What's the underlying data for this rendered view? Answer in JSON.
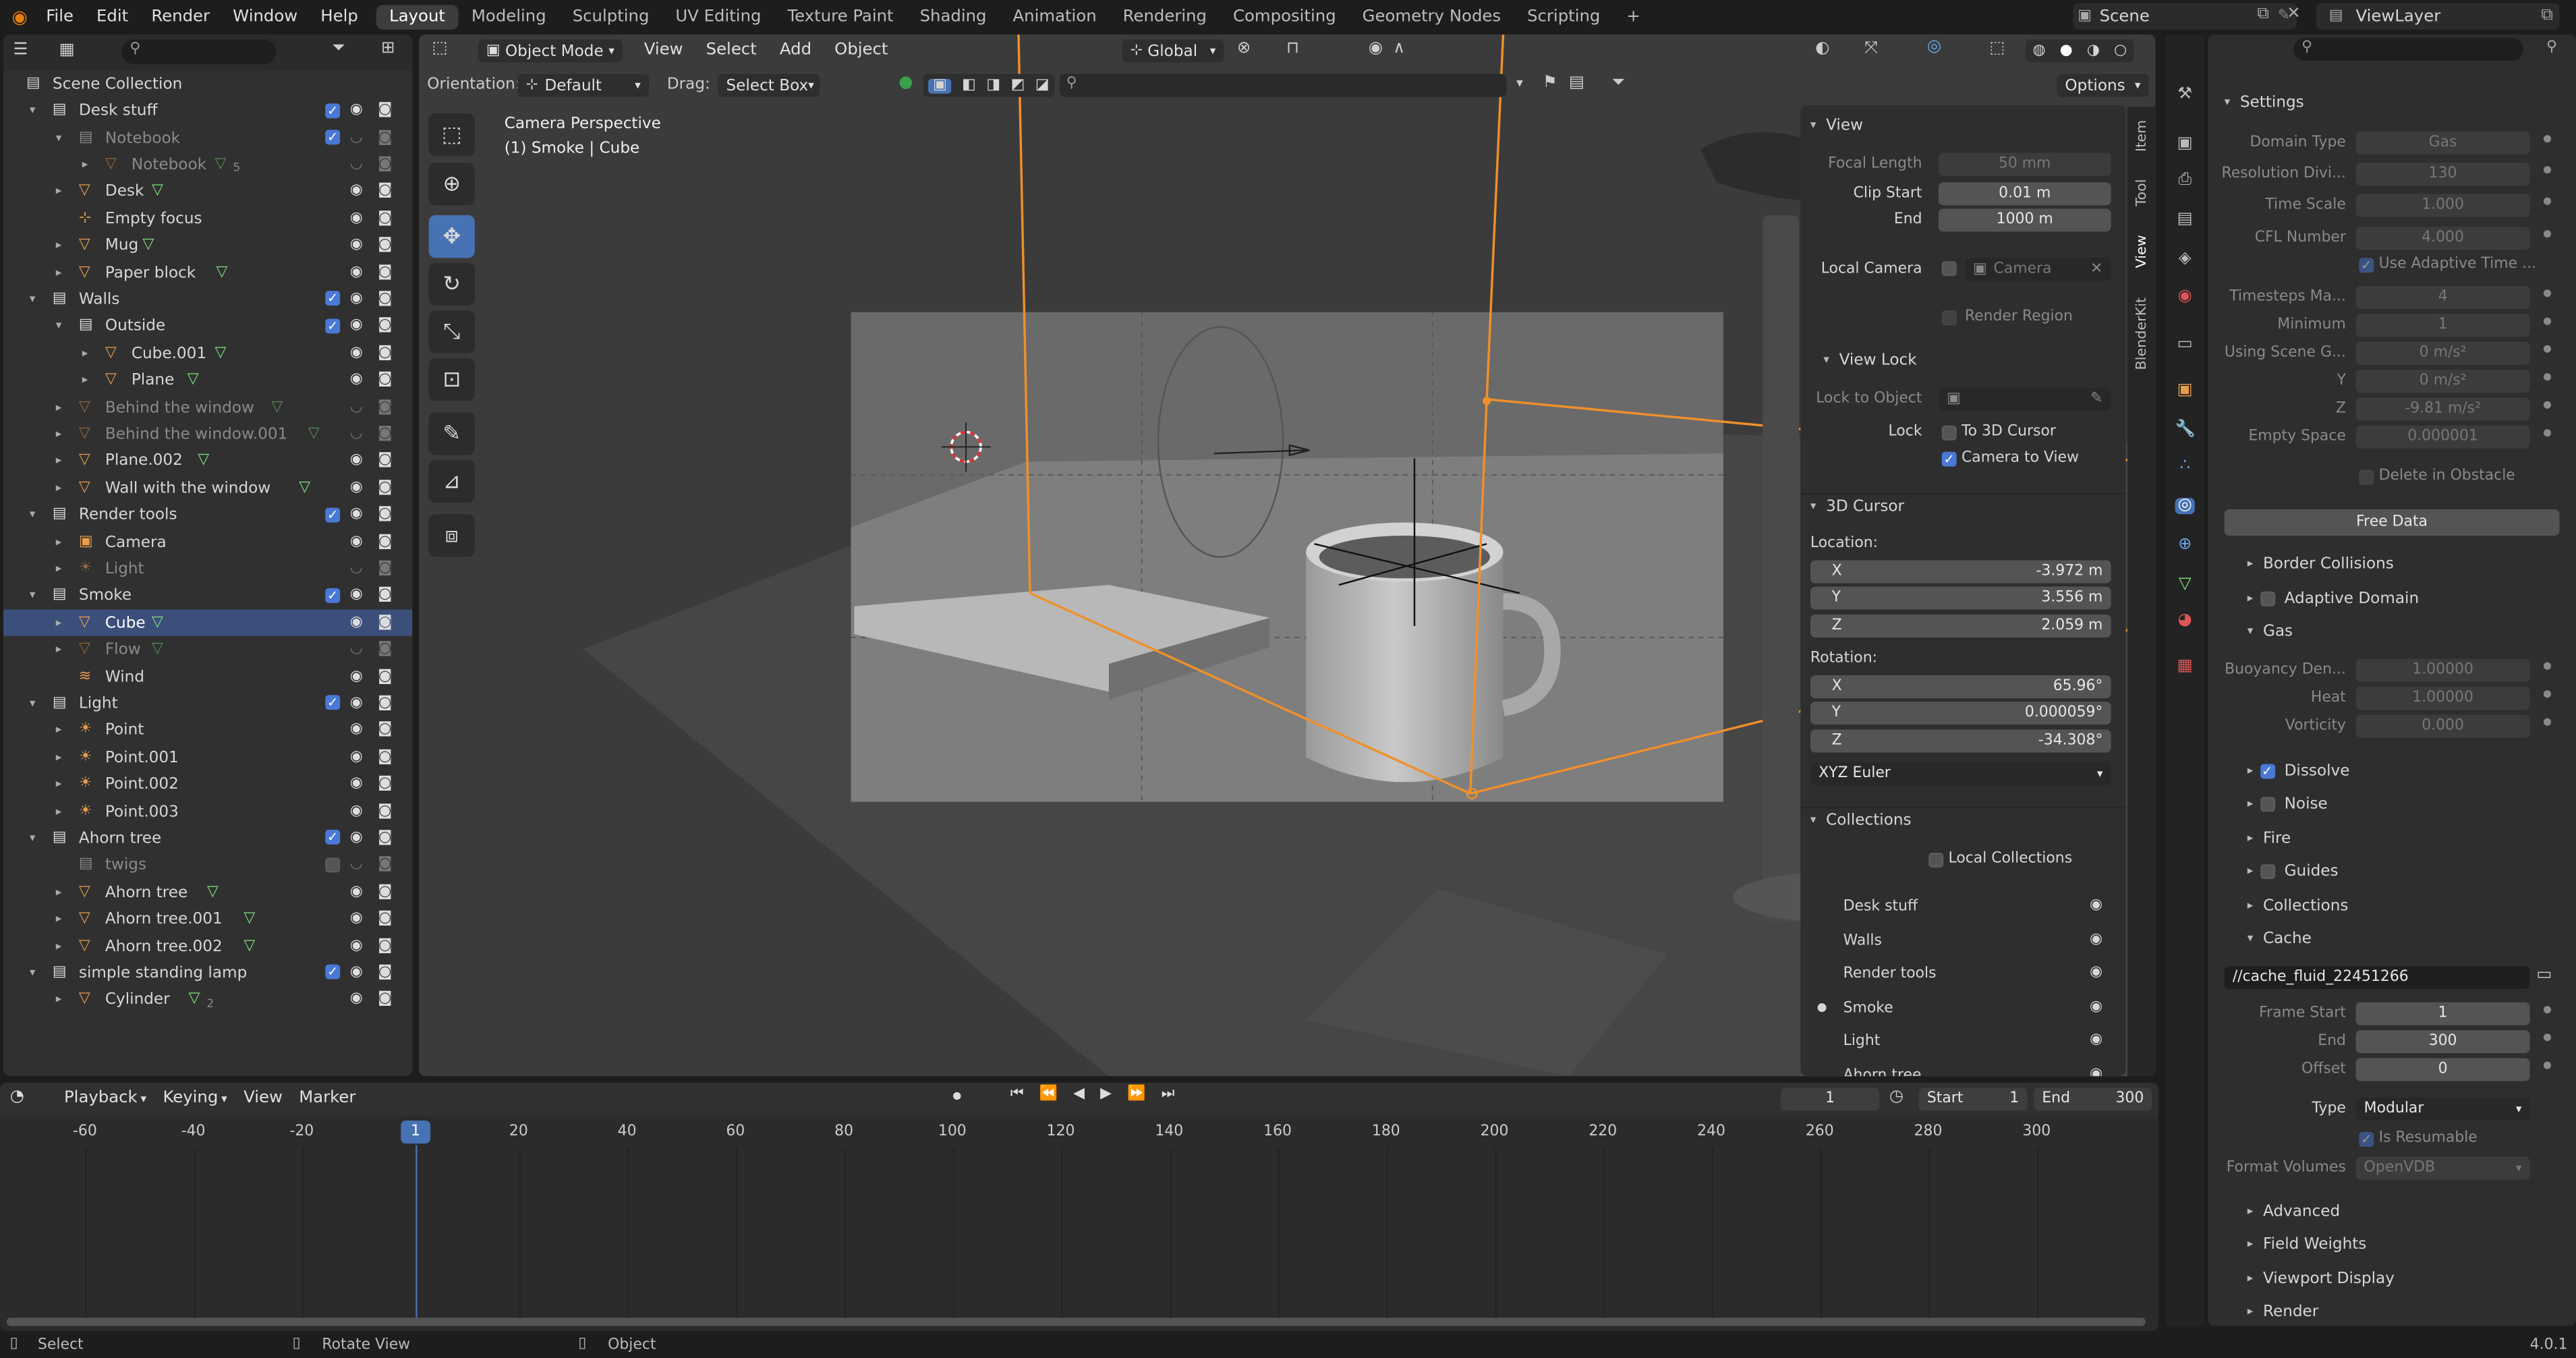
{
  "topbar": {
    "menus": [
      "File",
      "Edit",
      "Render",
      "Window",
      "Help"
    ],
    "workspaces": [
      "Layout",
      "Modeling",
      "Sculpting",
      "UV Editing",
      "Texture Paint",
      "Shading",
      "Animation",
      "Rendering",
      "Compositing",
      "Geometry Nodes",
      "Scripting"
    ],
    "active_workspace": "Layout",
    "scene": "Scene",
    "view_layer": "ViewLayer"
  },
  "outliner": {
    "root": "Scene Collection",
    "rows": [
      {
        "label": "Desk stuff",
        "depth": 1,
        "type": "collection",
        "expand": "down",
        "check": true
      },
      {
        "label": "Notebook",
        "depth": 2,
        "type": "collection",
        "expand": "down",
        "check": true,
        "dim": true
      },
      {
        "label": "Notebook",
        "depth": 3,
        "type": "object",
        "expand": "right",
        "dim": true,
        "badge": "5"
      },
      {
        "label": "Desk",
        "depth": 2,
        "type": "object",
        "expand": "right"
      },
      {
        "label": "Empty focus",
        "depth": 2,
        "type": "empty",
        "expand": ""
      },
      {
        "label": "Mug",
        "depth": 2,
        "type": "object",
        "expand": "right"
      },
      {
        "label": "Paper block",
        "depth": 2,
        "type": "object",
        "expand": "right"
      },
      {
        "label": "Walls",
        "depth": 1,
        "type": "collection",
        "expand": "down",
        "check": true
      },
      {
        "label": "Outside",
        "depth": 2,
        "type": "collection",
        "expand": "down",
        "check": true
      },
      {
        "label": "Cube.001",
        "depth": 3,
        "type": "object",
        "expand": "right"
      },
      {
        "label": "Plane",
        "depth": 3,
        "type": "object",
        "expand": "right"
      },
      {
        "label": "Behind the window",
        "depth": 2,
        "type": "object",
        "expand": "right",
        "dim": true
      },
      {
        "label": "Behind the window.001",
        "depth": 2,
        "type": "object",
        "expand": "right",
        "dim": true
      },
      {
        "label": "Plane.002",
        "depth": 2,
        "type": "object",
        "expand": "right"
      },
      {
        "label": "Wall with the window",
        "depth": 2,
        "type": "object",
        "expand": "right"
      },
      {
        "label": "Render tools",
        "depth": 1,
        "type": "collection",
        "expand": "down",
        "check": true
      },
      {
        "label": "Camera",
        "depth": 2,
        "type": "camera",
        "expand": "right"
      },
      {
        "label": "Light",
        "depth": 2,
        "type": "light",
        "expand": "right",
        "dim": true
      },
      {
        "label": "Smoke",
        "depth": 1,
        "type": "collection",
        "expand": "down",
        "check": true
      },
      {
        "label": "Cube",
        "depth": 2,
        "type": "object",
        "expand": "right",
        "selected": true
      },
      {
        "label": "Flow",
        "depth": 2,
        "type": "object",
        "expand": "right",
        "dim": true
      },
      {
        "label": "Wind",
        "depth": 2,
        "type": "force",
        "expand": ""
      },
      {
        "label": "Light",
        "depth": 1,
        "type": "collection",
        "expand": "down",
        "check": true
      },
      {
        "label": "Point",
        "depth": 2,
        "type": "light",
        "expand": "right"
      },
      {
        "label": "Point.001",
        "depth": 2,
        "type": "light",
        "expand": "right"
      },
      {
        "label": "Point.002",
        "depth": 2,
        "type": "light",
        "expand": "right"
      },
      {
        "label": "Point.003",
        "depth": 2,
        "type": "light",
        "expand": "right"
      },
      {
        "label": "Ahorn tree",
        "depth": 1,
        "type": "collection",
        "expand": "down",
        "check": true
      },
      {
        "label": "twigs",
        "depth": 2,
        "type": "collection",
        "expand": "",
        "dim": true,
        "check": false
      },
      {
        "label": "Ahorn tree",
        "depth": 2,
        "type": "object",
        "expand": "right"
      },
      {
        "label": "Ahorn tree.001",
        "depth": 2,
        "type": "object",
        "expand": "right"
      },
      {
        "label": "Ahorn tree.002",
        "depth": 2,
        "type": "object",
        "expand": "right"
      },
      {
        "label": "simple standing lamp",
        "depth": 1,
        "type": "collection",
        "expand": "down",
        "check": true
      },
      {
        "label": "Cylinder",
        "depth": 2,
        "type": "object",
        "expand": "right",
        "badge": "2"
      }
    ]
  },
  "viewport": {
    "mode": "Object Mode",
    "menus": [
      "View",
      "Select",
      "Add",
      "Object"
    ],
    "transform": "Global",
    "orientation_label": "Orientation:",
    "orientation": "Default",
    "drag_label": "Drag:",
    "drag": "Select Box",
    "options": "Options",
    "overlay_title": "Camera Perspective",
    "overlay_sub": "(1) Smoke | Cube"
  },
  "npanel": {
    "tabs": [
      "Item",
      "Tool",
      "View",
      "BlenderKit"
    ],
    "view": {
      "title": "View",
      "focal_label": "Focal Length",
      "focal": "50 mm",
      "clip_start_label": "Clip Start",
      "clip_start": "0.01 m",
      "end_label": "End",
      "clip_end": "1000 m",
      "local_camera_label": "Local Camera",
      "camera": "Camera",
      "render_region": "Render Region"
    },
    "view_lock": {
      "title": "View Lock",
      "lock_obj_label": "Lock to Object",
      "lock_label": "Lock",
      "to_cursor": "To 3D Cursor",
      "cam_to_view": "Camera to View"
    },
    "cursor": {
      "title": "3D Cursor",
      "location": "Location:",
      "loc": [
        [
          "X",
          "-3.972 m"
        ],
        [
          "Y",
          "3.556 m"
        ],
        [
          "Z",
          "2.059 m"
        ]
      ],
      "rotation": "Rotation:",
      "rot": [
        [
          "X",
          "65.96°"
        ],
        [
          "Y",
          "0.000059°"
        ],
        [
          "Z",
          "-34.308°"
        ]
      ],
      "mode": "XYZ Euler"
    },
    "collections": {
      "title": "Collections",
      "local": "Local Collections",
      "items": [
        "Desk stuff",
        "Walls",
        "Render tools",
        "Smoke",
        "Light",
        "Ahorn tree"
      ],
      "active": "Smoke"
    }
  },
  "properties": {
    "settings_title": "Settings",
    "rows": [
      [
        "Domain Type",
        "Gas"
      ],
      [
        "Resolution Divi...",
        "130"
      ],
      [
        "Time Scale",
        "1.000"
      ],
      [
        "CFL Number",
        "4.000"
      ]
    ],
    "adaptive_time": "Use Adaptive Time ...",
    "rows2": [
      [
        "Timesteps Ma...",
        "4"
      ],
      [
        "Minimum",
        "1"
      ],
      [
        "Using Scene G...",
        "0 m/s²"
      ],
      [
        "Y",
        "0 m/s²"
      ],
      [
        "Z",
        "-9.81 m/s²"
      ],
      [
        "Empty Space",
        "0.000001"
      ]
    ],
    "delete_obstacle": "Delete in Obstacle",
    "free_data": "Free Data",
    "border_collisions": "Border Collisions",
    "adaptive_domain": "Adaptive Domain",
    "gas": "Gas",
    "gas_rows": [
      [
        "Buoyancy Den...",
        "1.00000"
      ],
      [
        "Heat",
        "1.00000"
      ],
      [
        "Vorticity",
        "0.000"
      ]
    ],
    "subs": [
      "Dissolve",
      "Noise",
      "Fire",
      "Guides",
      "Collections"
    ],
    "cache": "Cache",
    "cache_path": "//cache_fluid_22451266",
    "cache_rows": [
      [
        "Frame Start",
        "1"
      ],
      [
        "End",
        "300"
      ],
      [
        "Offset",
        "0"
      ]
    ],
    "type_label": "Type",
    "type": "Modular",
    "resumable": "Is Resumable",
    "format_label": "Format Volumes",
    "format": "OpenVDB",
    "tail": [
      "Advanced",
      "Field Weights",
      "Viewport Display",
      "Render"
    ]
  },
  "timeline": {
    "menus": [
      "Playback",
      "Keying",
      "View",
      "Marker"
    ],
    "current": "1",
    "start_label": "Start",
    "start": "1",
    "end_label": "End",
    "end": "300",
    "ticks": [
      "-60",
      "-40",
      "-20",
      "1",
      "20",
      "40",
      "60",
      "80",
      "100",
      "120",
      "140",
      "160",
      "180",
      "200",
      "220",
      "240",
      "260",
      "280",
      "300"
    ]
  },
  "statusbar": {
    "select": "Select",
    "rotate": "Rotate View",
    "object": "Object",
    "version": "4.0.1"
  }
}
